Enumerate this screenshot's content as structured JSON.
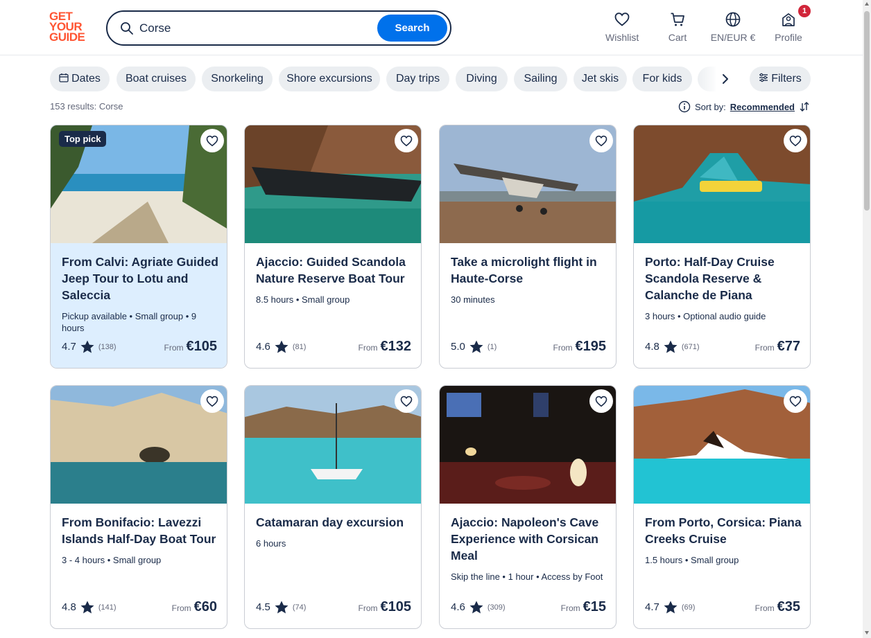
{
  "header": {
    "logo": [
      "GET",
      "YOUR",
      "GUIDE"
    ],
    "search_value": "Corse",
    "search_button": "Search",
    "nav": {
      "wishlist": "Wishlist",
      "cart": "Cart",
      "language": "EN/EUR €",
      "profile": "Profile",
      "profile_badge": "1"
    }
  },
  "chips": [
    "Dates",
    "Boat cruises",
    "Snorkeling",
    "Shore excursions",
    "Day trips",
    "Diving",
    "Sailing",
    "Jet skis",
    "For kids"
  ],
  "filters_label": "Filters",
  "results_text": "153 results: Corse",
  "sort": {
    "label": "Sort by:",
    "value": "Recommended"
  },
  "colors": {
    "brand": "#ff5533",
    "primary": "#0071eb",
    "navy": "#1a2b49",
    "highlight": "#ddeefe",
    "badge": "#d1263a"
  },
  "cards": [
    {
      "title": "From Calvi: Agriate Guided Jeep Tour to Lotu and Saleccia",
      "meta": "Pickup available • Small group • 9 hours",
      "rating": "4.7",
      "reviews": "(138)",
      "from": "From",
      "price": "€105",
      "badge": "Top pick"
    },
    {
      "title": "Ajaccio: Guided Scandola Nature Reserve Boat Tour",
      "meta": "8.5 hours • Small group",
      "rating": "4.6",
      "reviews": "(81)",
      "from": "From",
      "price": "€132"
    },
    {
      "title": "Take a microlight flight in Haute-Corse",
      "meta": "30 minutes",
      "rating": "5.0",
      "reviews": "(1)",
      "from": "From",
      "price": "€195"
    },
    {
      "title": "Porto: Half-Day Cruise Scandola Reserve & Calanche de Piana",
      "meta": "3 hours • Optional audio guide",
      "rating": "4.8",
      "reviews": "(671)",
      "from": "From",
      "price": "€77"
    },
    {
      "title": "From Bonifacio: Lavezzi Islands Half-Day Boat Tour",
      "meta": "3 - 4 hours • Small group",
      "rating": "4.8",
      "reviews": "(141)",
      "from": "From",
      "price": "€60"
    },
    {
      "title": "Catamaran day excursion",
      "meta": "6 hours",
      "rating": "4.5",
      "reviews": "(74)",
      "from": "From",
      "price": "€105"
    },
    {
      "title": "Ajaccio: Napoleon's Cave Experience with Corsican Meal",
      "meta": "Skip the line • 1 hour • Access by Foot",
      "rating": "4.6",
      "reviews": "(309)",
      "from": "From",
      "price": "€15"
    },
    {
      "title": "From Porto, Corsica: Piana Creeks Cruise",
      "meta": "1.5 hours • Small group",
      "rating": "4.7",
      "reviews": "(69)",
      "from": "From",
      "price": "€35"
    }
  ]
}
